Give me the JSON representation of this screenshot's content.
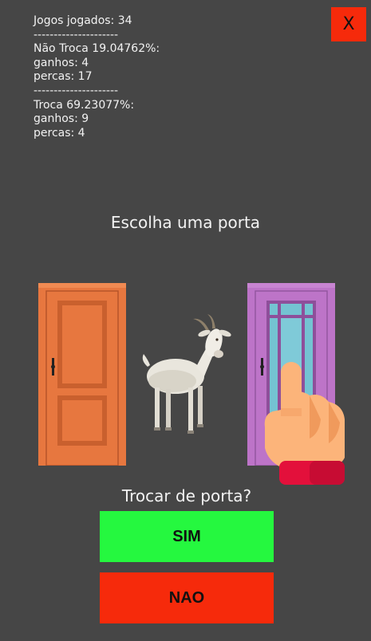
{
  "stats": {
    "games_played": "Jogos jogados: 34",
    "separator": "---------------------",
    "no_swap_header": "Não Troca 19.04762%:",
    "no_swap_wins": "ganhos: 4",
    "no_swap_losses": "percas: 17",
    "swap_header": "Troca 69.23077%:",
    "swap_wins": "ganhos: 9",
    "swap_losses": "percas: 4"
  },
  "close_label": "X",
  "choose_prompt": "Escolha uma porta",
  "swap_prompt": "Trocar de porta?",
  "yes_label": "SIM",
  "no_label": "NAO",
  "colors": {
    "background": "#464646",
    "close_button": "#f62a0b",
    "yes_button": "#25f83f",
    "no_button": "#f62a0b",
    "orange_door": "#e7773f",
    "purple_door": "#bd74c8",
    "glass": "#74c3d2"
  },
  "icons": {
    "left_door": "orange-panel-door",
    "middle": "goat",
    "right_door": "purple-glass-door",
    "pointer": "pointing-hand"
  }
}
